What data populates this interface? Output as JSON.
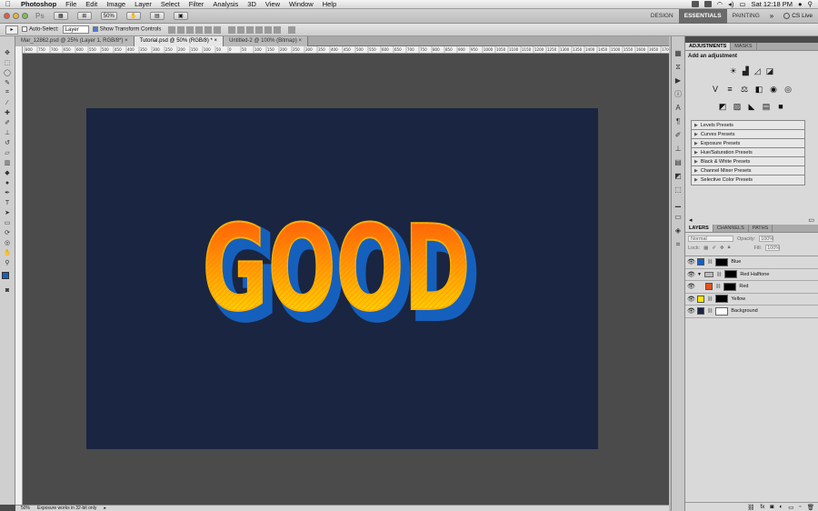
{
  "menubar": {
    "apple": "",
    "app_name": "Photoshop",
    "items": [
      "File",
      "Edit",
      "Image",
      "Layer",
      "Select",
      "Filter",
      "Analysis",
      "3D",
      "View",
      "Window",
      "Help"
    ],
    "clock": "Sat 12:18 PM"
  },
  "appbar": {
    "logo": "Ps",
    "zoom": "50%",
    "workspaces": [
      "DESIGN",
      "ESSENTIALS",
      "PAINTING"
    ],
    "active_workspace": "ESSENTIALS",
    "more": "»",
    "cs_live": "CS Live"
  },
  "options": {
    "auto_select_label": "Auto-Select:",
    "auto_select_value": "Layer",
    "show_transform_label": "Show Transform Controls"
  },
  "tabs": [
    {
      "label": "Mar_12862.psd @ 25% (Layer 1, RGB/8*) ×"
    },
    {
      "label": "Tutorial.psd @ 50% (RGB/8) * ×"
    },
    {
      "label": "Untitled-2 @ 100% (Bitmap) ×"
    }
  ],
  "ruler_ticks": [
    "800",
    "750",
    "700",
    "650",
    "600",
    "550",
    "500",
    "450",
    "400",
    "350",
    "300",
    "250",
    "200",
    "150",
    "100",
    "50",
    "0",
    "50",
    "100",
    "150",
    "200",
    "250",
    "300",
    "350",
    "400",
    "450",
    "500",
    "550",
    "600",
    "650",
    "700",
    "750",
    "800",
    "850",
    "900",
    "950",
    "1000",
    "1050",
    "1100",
    "1150",
    "1200",
    "1250",
    "1300",
    "1350",
    "1400",
    "1450",
    "1500",
    "1550",
    "1600",
    "1650",
    "1700",
    "1750",
    "1800"
  ],
  "canvas": {
    "text": "GOOD",
    "background_color": "#1a2541",
    "fill_top": "#ff4a0a",
    "fill_bottom": "#ffee00",
    "extrude_color": "#1560bd"
  },
  "status": {
    "zoom": "50%",
    "message": "Exposure works in 32-bit only"
  },
  "adjustments": {
    "tabs": [
      "ADJUSTMENTS",
      "MASKS"
    ],
    "title": "Add an adjustment",
    "presets": [
      "Levels Presets",
      "Curves Presets",
      "Exposure Presets",
      "Hue/Saturation Presets",
      "Black & White Presets",
      "Channel Mixer Presets",
      "Selective Color Presets"
    ]
  },
  "layers_panel": {
    "tabs": [
      "LAYERS",
      "CHANNELS",
      "PATHS"
    ],
    "blend_mode": "Normal",
    "opacity_label": "Opacity:",
    "opacity_value": "100%",
    "lock_label": "Lock:",
    "fill_label": "Fill:",
    "fill_value": "100%",
    "layers": [
      {
        "name": "Blue",
        "color": "#1560bd",
        "mask": true,
        "indent": false,
        "folder": false
      },
      {
        "name": "Red Halftone",
        "color": "",
        "mask": true,
        "indent": false,
        "folder": true
      },
      {
        "name": "Red",
        "color": "#e8501a",
        "mask": true,
        "indent": true,
        "folder": false
      },
      {
        "name": "Yellow",
        "color": "#ffe600",
        "mask": true,
        "indent": false,
        "folder": false
      },
      {
        "name": "Background",
        "color": "#1a2541",
        "mask": false,
        "indent": false,
        "folder": false
      }
    ]
  }
}
